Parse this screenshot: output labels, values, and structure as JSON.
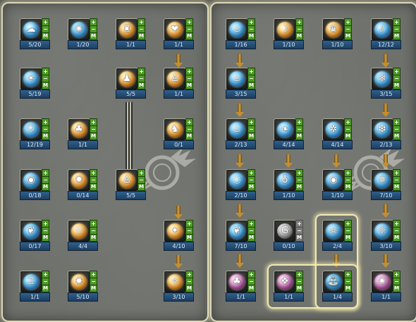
{
  "colors": {
    "button_green": "#4e9b25",
    "level_blue": "#2f5f8c",
    "panel_border": "#d9d7b6",
    "arrow_gold": "#c48f2f"
  },
  "button_labels": {
    "plus": "+",
    "minus": "−",
    "max": "M"
  },
  "left_tree": [
    {
      "name": "skill-l-1-1",
      "level": "5/20",
      "style": "cool",
      "icon": "cloud-icon",
      "glyph": "☁"
    },
    {
      "name": "skill-l-1-2",
      "level": "1/20",
      "style": "cool",
      "icon": "swirl-icon",
      "glyph": "✺"
    },
    {
      "name": "skill-l-1-3",
      "level": "1/1",
      "style": "warm",
      "icon": "altar-icon",
      "glyph": "♜"
    },
    {
      "name": "skill-l-1-4",
      "level": "1/1",
      "style": "warm",
      "icon": "heart-icon",
      "glyph": "❤"
    },
    {
      "name": "skill-l-2-1",
      "level": "5/19",
      "style": "cool",
      "icon": "star-icon",
      "glyph": "✶"
    },
    {
      "name": "skill-l-2-3",
      "level": "5/5",
      "style": "warm",
      "icon": "figure-icon",
      "glyph": "♟"
    },
    {
      "name": "skill-l-2-4",
      "level": "1/1",
      "style": "warm",
      "icon": "figure-icon",
      "glyph": "♙"
    },
    {
      "name": "skill-l-3-1",
      "level": "12/19",
      "style": "cool",
      "icon": "shield-icon",
      "glyph": "⛉"
    },
    {
      "name": "skill-l-3-2",
      "level": "1/1",
      "style": "warm",
      "icon": "mushroom-icon",
      "glyph": "♣"
    },
    {
      "name": "skill-l-3-4",
      "level": "0/1",
      "style": "warm",
      "icon": "figure-icon",
      "glyph": "♞"
    },
    {
      "name": "skill-l-4-1",
      "level": "0/18",
      "style": "cool",
      "icon": "orb-icon",
      "glyph": "◉"
    },
    {
      "name": "skill-l-4-2",
      "level": "0/14",
      "style": "warm",
      "icon": "beast-icon",
      "glyph": "✹"
    },
    {
      "name": "skill-l-4-3",
      "level": "5/5",
      "style": "warm",
      "icon": "figure-icon",
      "glyph": "♙"
    },
    {
      "name": "skill-l-5-1",
      "level": "0/17",
      "style": "cool",
      "icon": "wings-icon",
      "glyph": "❦"
    },
    {
      "name": "skill-l-5-2",
      "level": "4/4",
      "style": "warm",
      "icon": "figure-icon",
      "glyph": "♘"
    },
    {
      "name": "skill-l-5-4",
      "level": "4/10",
      "style": "warm",
      "icon": "crest-icon",
      "glyph": "✦"
    },
    {
      "name": "skill-l-6-1",
      "level": "1/1",
      "style": "cool",
      "icon": "tower-icon",
      "glyph": "♖"
    },
    {
      "name": "skill-l-6-2",
      "level": "5/10",
      "style": "warm",
      "icon": "beast-icon",
      "glyph": "✸"
    },
    {
      "name": "skill-l-6-4",
      "level": "3/10",
      "style": "warm",
      "icon": "crest-icon",
      "glyph": "✧"
    }
  ],
  "right_tree": [
    {
      "name": "skill-r-1-1",
      "level": "1/16",
      "style": "cool",
      "icon": "flame-icon",
      "glyph": "♨"
    },
    {
      "name": "skill-r-1-2",
      "level": "1/10",
      "style": "warm",
      "icon": "bowl-icon",
      "glyph": "☽"
    },
    {
      "name": "skill-r-1-3",
      "level": "1/10",
      "style": "warm",
      "icon": "crown-icon",
      "glyph": "♛"
    },
    {
      "name": "skill-r-1-4",
      "level": "12/12",
      "style": "cool",
      "icon": "slash-icon",
      "glyph": "⫽"
    },
    {
      "name": "skill-r-2-1",
      "level": "3/15",
      "style": "cool",
      "icon": "flame-icon",
      "glyph": "♨"
    },
    {
      "name": "skill-r-2-4",
      "level": "3/15",
      "style": "cool",
      "icon": "flame-icon",
      "glyph": "❄"
    },
    {
      "name": "skill-r-3-1",
      "level": "2/13",
      "style": "cool",
      "icon": "flame-icon",
      "glyph": "♨"
    },
    {
      "name": "skill-r-3-2",
      "level": "4/14",
      "style": "cool",
      "icon": "bird-icon",
      "glyph": "❧"
    },
    {
      "name": "skill-r-3-3",
      "level": "4/14",
      "style": "cool",
      "icon": "spark-icon",
      "glyph": "✲"
    },
    {
      "name": "skill-r-3-4",
      "level": "2/13",
      "style": "cool",
      "icon": "ice-icon",
      "glyph": "❆"
    },
    {
      "name": "skill-r-4-1",
      "level": "2/10",
      "style": "cool",
      "icon": "ring-icon",
      "glyph": "◌"
    },
    {
      "name": "skill-r-4-2",
      "level": "1/10",
      "style": "cool",
      "icon": "drop-icon",
      "glyph": "♁"
    },
    {
      "name": "skill-r-4-3",
      "level": "1/10",
      "style": "cool",
      "icon": "orb-icon",
      "glyph": "◉"
    },
    {
      "name": "skill-r-4-4",
      "level": "7/10",
      "style": "cool",
      "icon": "snowflake-icon",
      "glyph": "❅"
    },
    {
      "name": "skill-r-5-1",
      "level": "7/10",
      "style": "cool",
      "icon": "bird-icon",
      "glyph": "❦"
    },
    {
      "name": "skill-r-5-2",
      "level": "0/10",
      "style": "gray",
      "icon": "c-rune-icon",
      "glyph": "G"
    },
    {
      "name": "skill-r-5-3",
      "level": "2/4",
      "style": "cool",
      "icon": "skull-icon",
      "glyph": "☠"
    },
    {
      "name": "skill-r-5-4",
      "level": "3/10",
      "style": "cool",
      "icon": "wings-icon",
      "glyph": "❈"
    },
    {
      "name": "skill-r-6-1",
      "level": "1/1",
      "style": "pink",
      "icon": "tree-icon",
      "glyph": "♣"
    },
    {
      "name": "skill-r-6-2",
      "level": "1/1",
      "style": "pink",
      "icon": "crystal-icon",
      "glyph": "❖"
    },
    {
      "name": "skill-r-6-3",
      "level": "1/4",
      "style": "cool",
      "icon": "fountain-icon",
      "glyph": "⛲"
    },
    {
      "name": "skill-r-6-4",
      "level": "1/1",
      "style": "pink",
      "icon": "burst-icon",
      "glyph": "✺"
    }
  ]
}
